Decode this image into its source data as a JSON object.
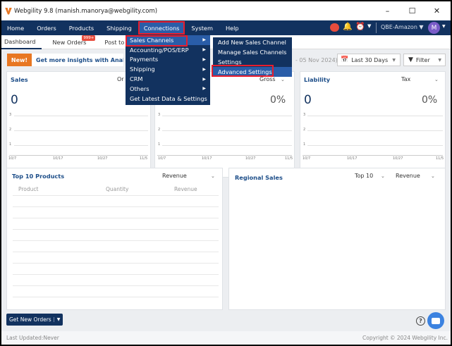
{
  "window": {
    "title": "Webgility 9.8 (manish.manorya@webgility.com)"
  },
  "menubar": {
    "items": [
      "Home",
      "Orders",
      "Products",
      "Shipping",
      "Connections",
      "System",
      "Help"
    ],
    "account": "QBE-Amazon",
    "avatar": "M"
  },
  "tabs": {
    "dashboard": "Dashboard",
    "new_orders": "New Orders",
    "new_orders_badge": "999+",
    "post_to": "Post to"
  },
  "banner": {
    "new": "New!",
    "text": "Get more insights with Analyt",
    "date_range_text": "- 05 Nov 2024)",
    "date_filter": "Last 30 Days",
    "filter": "Filter"
  },
  "connections_menu": {
    "items": [
      {
        "label": "Sales Channels",
        "arrow": "▶"
      },
      {
        "label": "Accounting/POS/ERP",
        "arrow": "▶"
      },
      {
        "label": "Payments",
        "arrow": "▶"
      },
      {
        "label": "Shipping",
        "arrow": "▶"
      },
      {
        "label": "CRM",
        "arrow": "▶"
      },
      {
        "label": "Others",
        "arrow": "▶"
      },
      {
        "label": "Get Latest Data & Settings",
        "arrow": ""
      }
    ]
  },
  "sales_channels_menu": {
    "items": [
      "Add New Sales Channel",
      "Manage Sales Channels",
      "Settings",
      "Advanced Settings"
    ]
  },
  "sales_card": {
    "title": "Sales",
    "dropdown": "Or",
    "value": "0",
    "y_ticks": [
      "3",
      "2",
      "1"
    ],
    "x_ticks": [
      "10/7",
      "10/17",
      "10/27",
      "11/5"
    ]
  },
  "gross_card": {
    "dropdown": "Gross",
    "value": "0%",
    "y_ticks": [
      "3",
      "2",
      "1"
    ],
    "x_ticks": [
      "10/7",
      "10/17",
      "10/27",
      "11/5"
    ]
  },
  "liability_card": {
    "title": "Liability",
    "dropdown": "Tax",
    "value": "0",
    "pct": "0%",
    "y_ticks": [
      "3",
      "2",
      "1"
    ],
    "x_ticks": [
      "10/7",
      "10/17",
      "10/27",
      "11/5"
    ]
  },
  "top_products": {
    "title": "Top 10 Products",
    "dropdown": "Revenue",
    "columns": [
      "Product",
      "Quantity",
      "Revenue"
    ]
  },
  "regional_sales": {
    "title": "Regional Sales",
    "dropdown1": "Top 10",
    "dropdown2": "Revenue"
  },
  "get_new_orders": {
    "label": "Get New Orders"
  },
  "footer": {
    "last_updated": "Last Updated:Never",
    "copyright": "Copyright © 2024 Webgility Inc."
  }
}
